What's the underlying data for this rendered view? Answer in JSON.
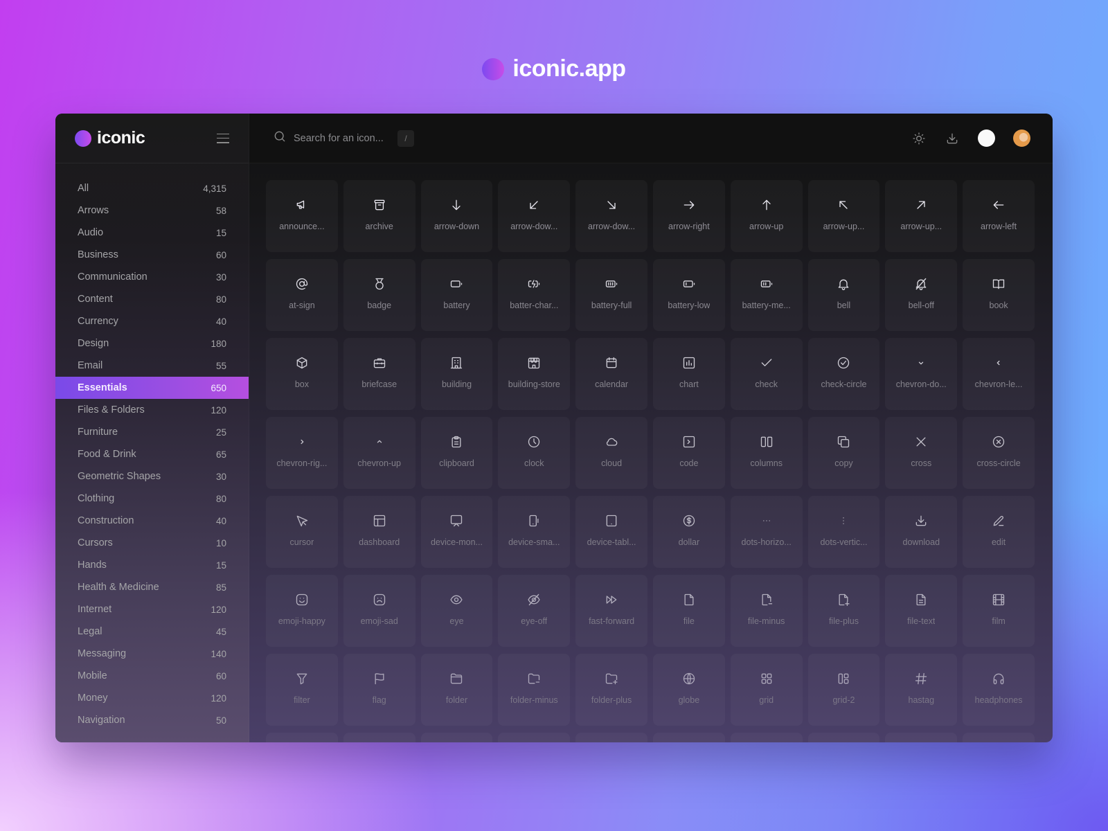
{
  "hero": {
    "title": "iconic.app"
  },
  "app": {
    "brand": "iconic",
    "search": {
      "placeholder": "Search for an icon...",
      "shortcut": "/"
    },
    "top_actions": [
      {
        "name": "theme-toggle",
        "icon": "sun-icon"
      },
      {
        "name": "download",
        "icon": "download-icon"
      },
      {
        "name": "status",
        "icon": "circle"
      },
      {
        "name": "user-avatar",
        "icon": "avatar"
      }
    ],
    "accent_color": "#8b4ce6",
    "categories": [
      {
        "label": "All",
        "count": "4,315"
      },
      {
        "label": "Arrows",
        "count": "58"
      },
      {
        "label": "Audio",
        "count": "15"
      },
      {
        "label": "Business",
        "count": "60"
      },
      {
        "label": "Communication",
        "count": "30"
      },
      {
        "label": "Content",
        "count": "80"
      },
      {
        "label": "Currency",
        "count": "40"
      },
      {
        "label": "Design",
        "count": "180"
      },
      {
        "label": "Email",
        "count": "55"
      },
      {
        "label": "Essentials",
        "count": "650",
        "active": true
      },
      {
        "label": "Files & Folders",
        "count": "120"
      },
      {
        "label": "Furniture",
        "count": "25"
      },
      {
        "label": "Food & Drink",
        "count": "65"
      },
      {
        "label": "Geometric Shapes",
        "count": "30"
      },
      {
        "label": "Clothing",
        "count": "80"
      },
      {
        "label": "Construction",
        "count": "40"
      },
      {
        "label": "Cursors",
        "count": "10"
      },
      {
        "label": "Hands",
        "count": "15"
      },
      {
        "label": "Health & Medicine",
        "count": "85"
      },
      {
        "label": "Internet",
        "count": "120"
      },
      {
        "label": "Legal",
        "count": "45"
      },
      {
        "label": "Messaging",
        "count": "140"
      },
      {
        "label": "Mobile",
        "count": "60"
      },
      {
        "label": "Money",
        "count": "120"
      },
      {
        "label": "Navigation",
        "count": "50"
      }
    ],
    "icons": [
      {
        "label": "announce...",
        "icon": "announcement"
      },
      {
        "label": "archive",
        "icon": "archive"
      },
      {
        "label": "arrow-down",
        "icon": "arrow-down"
      },
      {
        "label": "arrow-dow...",
        "icon": "arrow-down-left"
      },
      {
        "label": "arrow-dow...",
        "icon": "arrow-down-right"
      },
      {
        "label": "arrow-right",
        "icon": "arrow-right"
      },
      {
        "label": "arrow-up",
        "icon": "arrow-up"
      },
      {
        "label": "arrow-up...",
        "icon": "arrow-up-left"
      },
      {
        "label": "arrow-up...",
        "icon": "arrow-up-right"
      },
      {
        "label": "arrow-left",
        "icon": "arrow-left"
      },
      {
        "label": "at-sign",
        "icon": "at-sign"
      },
      {
        "label": "badge",
        "icon": "badge"
      },
      {
        "label": "battery",
        "icon": "battery"
      },
      {
        "label": "batter-char...",
        "icon": "battery-charging"
      },
      {
        "label": "battery-full",
        "icon": "battery-full"
      },
      {
        "label": "battery-low",
        "icon": "battery-low"
      },
      {
        "label": "battery-me...",
        "icon": "battery-medium"
      },
      {
        "label": "bell",
        "icon": "bell"
      },
      {
        "label": "bell-off",
        "icon": "bell-off"
      },
      {
        "label": "book",
        "icon": "book"
      },
      {
        "label": "box",
        "icon": "box"
      },
      {
        "label": "briefcase",
        "icon": "briefcase"
      },
      {
        "label": "building",
        "icon": "building"
      },
      {
        "label": "building-store",
        "icon": "building-store"
      },
      {
        "label": "calendar",
        "icon": "calendar"
      },
      {
        "label": "chart",
        "icon": "chart"
      },
      {
        "label": "check",
        "icon": "check"
      },
      {
        "label": "check-circle",
        "icon": "check-circle"
      },
      {
        "label": "chevron-do...",
        "icon": "chevron-down"
      },
      {
        "label": "chevron-le...",
        "icon": "chevron-left"
      },
      {
        "label": "chevron-rig...",
        "icon": "chevron-right"
      },
      {
        "label": "chevron-up",
        "icon": "chevron-up"
      },
      {
        "label": "clipboard",
        "icon": "clipboard"
      },
      {
        "label": "clock",
        "icon": "clock"
      },
      {
        "label": "cloud",
        "icon": "cloud"
      },
      {
        "label": "code",
        "icon": "code"
      },
      {
        "label": "columns",
        "icon": "columns"
      },
      {
        "label": "copy",
        "icon": "copy"
      },
      {
        "label": "cross",
        "icon": "cross"
      },
      {
        "label": "cross-circle",
        "icon": "cross-circle"
      },
      {
        "label": "cursor",
        "icon": "cursor"
      },
      {
        "label": "dashboard",
        "icon": "dashboard"
      },
      {
        "label": "device-mon...",
        "icon": "device-monitor"
      },
      {
        "label": "device-sma...",
        "icon": "device-smartphone"
      },
      {
        "label": "device-tabl...",
        "icon": "device-tablet"
      },
      {
        "label": "dollar",
        "icon": "dollar"
      },
      {
        "label": "dots-horizo...",
        "icon": "dots-horizontal"
      },
      {
        "label": "dots-vertic...",
        "icon": "dots-vertical"
      },
      {
        "label": "download",
        "icon": "download"
      },
      {
        "label": "edit",
        "icon": "edit"
      },
      {
        "label": "emoji-happy",
        "icon": "emoji-happy"
      },
      {
        "label": "emoji-sad",
        "icon": "emoji-sad"
      },
      {
        "label": "eye",
        "icon": "eye"
      },
      {
        "label": "eye-off",
        "icon": "eye-off"
      },
      {
        "label": "fast-forward",
        "icon": "fast-forward"
      },
      {
        "label": "file",
        "icon": "file"
      },
      {
        "label": "file-minus",
        "icon": "file-minus"
      },
      {
        "label": "file-plus",
        "icon": "file-plus"
      },
      {
        "label": "file-text",
        "icon": "file-text"
      },
      {
        "label": "film",
        "icon": "film"
      },
      {
        "label": "filter",
        "icon": "filter"
      },
      {
        "label": "flag",
        "icon": "flag"
      },
      {
        "label": "folder",
        "icon": "folder"
      },
      {
        "label": "folder-minus",
        "icon": "folder-minus"
      },
      {
        "label": "folder-plus",
        "icon": "folder-plus"
      },
      {
        "label": "globe",
        "icon": "globe"
      },
      {
        "label": "grid",
        "icon": "grid"
      },
      {
        "label": "grid-2",
        "icon": "grid-2"
      },
      {
        "label": "hastag",
        "icon": "hashtag"
      },
      {
        "label": "headphones",
        "icon": "headphones"
      }
    ]
  }
}
